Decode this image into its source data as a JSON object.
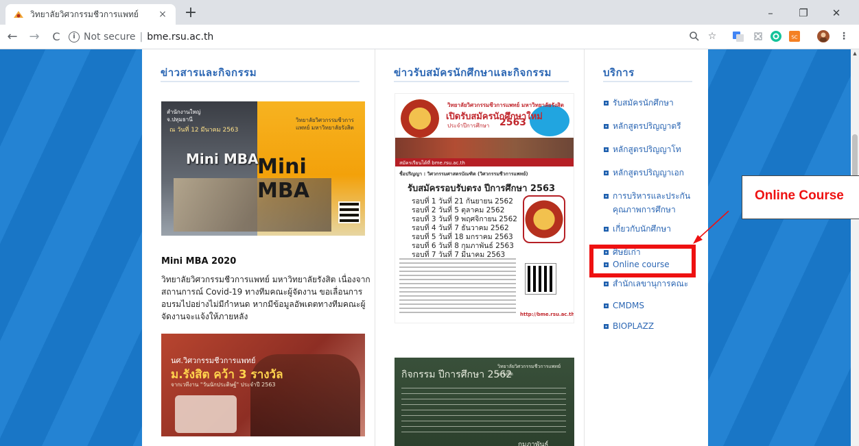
{
  "browser": {
    "tab_title": "วิทยาลัยวิศวกรรมชีวการแพทย์",
    "tab_close": "×",
    "new_tab": "+",
    "window_controls": {
      "minimize": "–",
      "restore": "❐",
      "close": "✕"
    },
    "nav": {
      "back": "←",
      "forward": "→",
      "reload": "C"
    },
    "security_label": "Not secure",
    "url": "bme.rsu.ac.th",
    "ext_sc_label": "SC",
    "menu": "⋮"
  },
  "page": {
    "col1": {
      "heading": "ข่าวสารและกิจกรรม",
      "news1": {
        "image": {
          "info_top": "สำนักงานใหญ่ จ.ปทุมธานี",
          "date": "ณ วันที่ 12 มีนาคม 2563",
          "org": "วิทยาลัยวิศวกรรมชีวการแพทย์ มหาวิทยาลัยรังสิต",
          "mba_small": "Mini MBA",
          "mba_big": "Mini MBA"
        },
        "title": "Mini MBA 2020",
        "body": "วิทยาลัยวิศวกรรมชีวการแพทย์ มหาวิทยาลัยรังสิต เนื่องจากสถานการณ์ Covid-19 ทางทีมคณะผู้จัดงาน ขอเลื่อนการอบรมไปอย่างไม่มีกำหนด หากมีข้อมูลอัพเดตทางทีมคณะผู้จัดงานจะแจ้งให้ภายหลัง"
      },
      "news2": {
        "image": {
          "line1": "นศ.วิศวกรรมชีวการแพทย์",
          "line2": "ม.รังสิต คว้า 3 รางวัล",
          "line3": "จากเวทีงาน \"วันนักประดิษฐ์\" ประจำปี 2563"
        }
      }
    },
    "col2": {
      "heading": "ข่าวรับสมัครนักศึกษาและกิจกรรม",
      "poster": {
        "t1": "วิทยาลัยวิศวกรรมชีวการแพทย์ มหาวิทยาลัยรังสิต",
        "t2": "เปิดรับสมัครนักศึกษาใหม่",
        "t3": "ประจำปีการศึกษา",
        "year": "2563",
        "contact": "สมัครเรียนได้ที่ bme.rsu.ac.th",
        "degree": "ชื่อปริญญา : วิศวกรรมศาสตรบัณฑิต (วิศวกรรมชีวการแพทย์)",
        "headline": "รับสมัครรอบรับตรง ปีการศึกษา 2563",
        "rounds": [
          "รอบที่ 1  วันที่  21  กันยายน  2562",
          "รอบที่ 2  วันที่  5  ตุลาคม  2562",
          "รอบที่ 3  วันที่  9  พฤศจิกายน  2562",
          "รอบที่ 4  วันที่  7  ธันวาคม  2562",
          "รอบที่ 5  วันที่  18  มกราคม  2563",
          "รอบที่ 6  วันที่  8  กุมภาพันธ์  2563",
          "รอบที่ 7  วันที่  7  มีนาคม  2563"
        ],
        "url": "http://bme.rsu.ac.th/"
      },
      "board": {
        "title": "กิจกรรม ปีการศึกษา 2562",
        "subtitle": "วิทยาลัยวิศวกรรมชีวการแพทย์ ม.รังสิต",
        "footer": "กุมภาพันธ์"
      }
    },
    "col3": {
      "heading": "บริการ",
      "items": [
        "รับสมัครนักศึกษา",
        "หลักสูตรปริญญาตรี",
        "หลักสูตรปริญญาโท",
        "หลักสูตรปริญญาเอก",
        "การบริหารและประกันคุณภาพการศึกษา",
        "เกี่ยวกับนักศึกษา",
        "ศิษย์เก่า",
        "Online course",
        "สำนักเลขานุการคณะ",
        "CMDMS",
        "BIOPLAZZ"
      ]
    }
  },
  "annotation": {
    "callout": "Online Course",
    "color": "#ee1111"
  },
  "colors": {
    "accent": "#2b66b3",
    "background": "#1976c6"
  }
}
